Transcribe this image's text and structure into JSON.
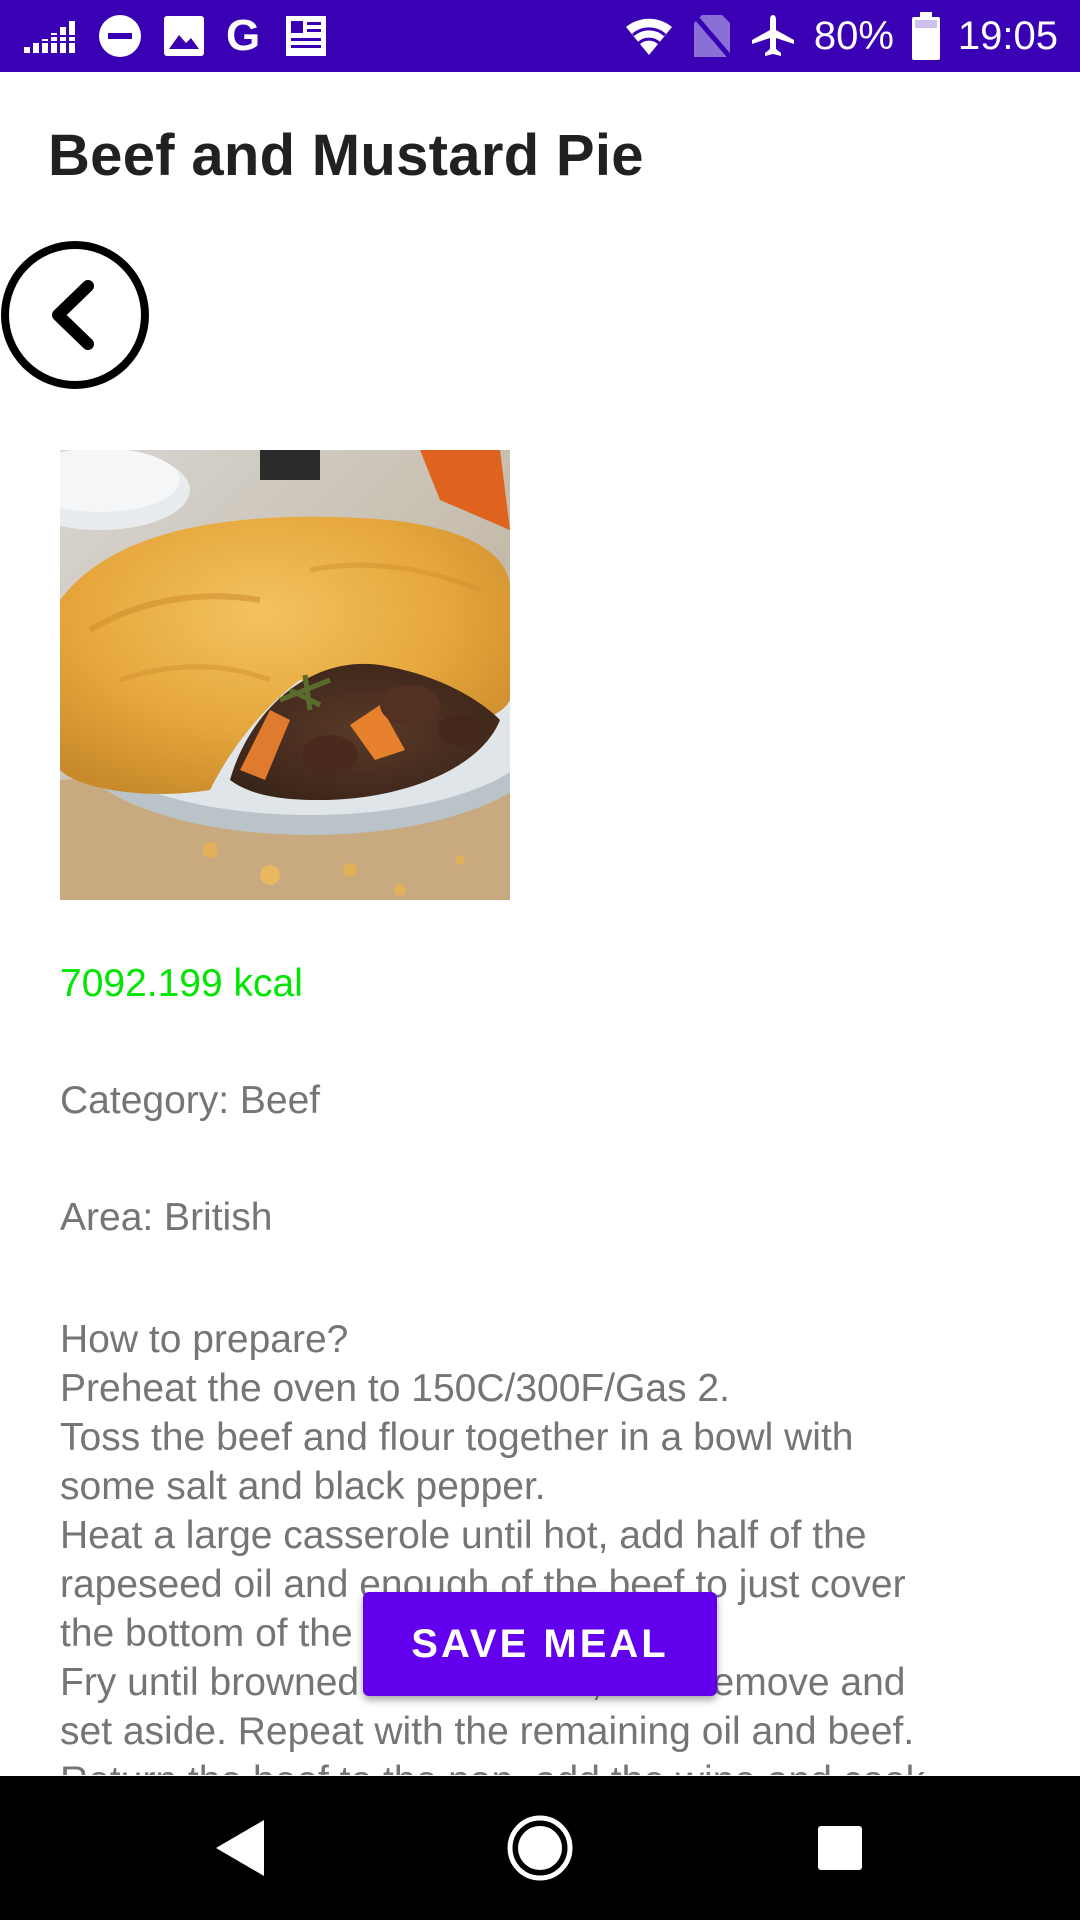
{
  "status_bar": {
    "battery_percent": "80%",
    "time": "19:05",
    "background_color": "#3A00B3",
    "left_icons": [
      "signal-bars-icon",
      "do-not-disturb-icon",
      "image-icon",
      "google-g-icon",
      "news-icon"
    ],
    "right_icons": [
      "wifi-icon",
      "no-sim-icon",
      "airplane-icon",
      "battery-icon"
    ]
  },
  "header": {
    "title": "Beef and Mustard Pie"
  },
  "meal": {
    "kcal": "7092.199 kcal",
    "category": "Category: Beef",
    "area": "Area: British",
    "instructions": [
      "How to prepare?",
      "Preheat the oven to 150C/300F/Gas 2.",
      "Toss the beef and flour together in a bowl with",
      "some salt and black pepper.",
      "Heat a large casserole until hot, add half of the",
      "rapeseed oil and enough of the beef to just cover",
      "the bottom of the casserole.",
      "Fry until browned on each side, then remove and",
      "set aside. Repeat with the remaining oil and beef.",
      "Return the beef to the pan, add the wine and cook"
    ]
  },
  "actions": {
    "save_label": "SAVE MEAL"
  },
  "colors": {
    "accent": "#6200EE",
    "kcal_green": "#00E600",
    "body_text": "#757575",
    "title_text": "#212121"
  }
}
